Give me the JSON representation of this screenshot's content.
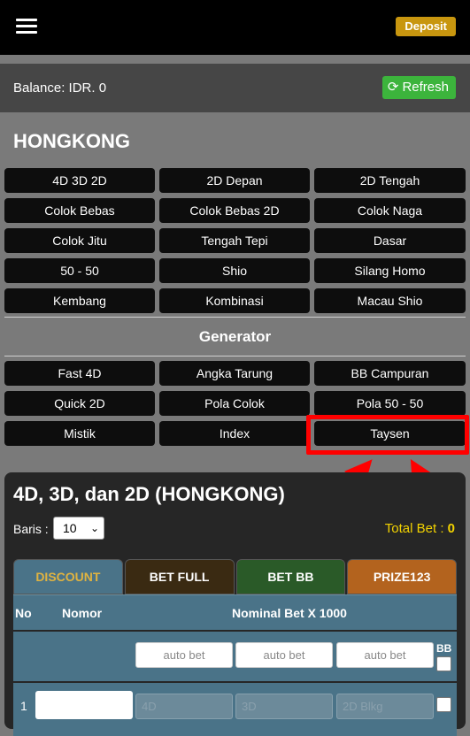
{
  "header": {
    "deposit_label": "Deposit"
  },
  "balance": {
    "label": "Balance: IDR. 0",
    "refresh_label": "Refresh"
  },
  "market": {
    "title": "HONGKONG"
  },
  "game_buttons": [
    "4D 3D 2D",
    "2D Depan",
    "2D Tengah",
    "Colok Bebas",
    "Colok Bebas 2D",
    "Colok Naga",
    "Colok Jitu",
    "Tengah Tepi",
    "Dasar",
    "50 - 50",
    "Shio",
    "Silang Homo",
    "Kembang",
    "Kombinasi",
    "Macau Shio"
  ],
  "generator": {
    "title": "Generator",
    "buttons": [
      "Fast 4D",
      "Angka Tarung",
      "BB Campuran",
      "Quick 2D",
      "Pola Colok",
      "Pola 50 - 50",
      "Mistik",
      "Index",
      "Taysen"
    ]
  },
  "panel": {
    "title": "4D, 3D, dan 2D (HONGKONG)",
    "baris_label": "Baris :",
    "baris_value": "10",
    "total_bet_label": "Total Bet :",
    "total_bet_value": "0",
    "tabs": [
      "DISCOUNT",
      "BET FULL",
      "BET BB",
      "PRIZE123"
    ],
    "columns": {
      "no": "No",
      "nomor": "Nomor",
      "nominal": "Nominal Bet X 1000",
      "bb": "BB"
    },
    "auto_bet_placeholder": "auto bet",
    "row": {
      "no": "1",
      "placeholders": [
        "4D",
        "3D",
        "2D Blkg"
      ]
    }
  },
  "colors": {
    "accent_gold": "#c8960f",
    "refresh_green": "#3cb43c",
    "highlight_red": "#ff0000",
    "table_blue": "#4a7388"
  }
}
